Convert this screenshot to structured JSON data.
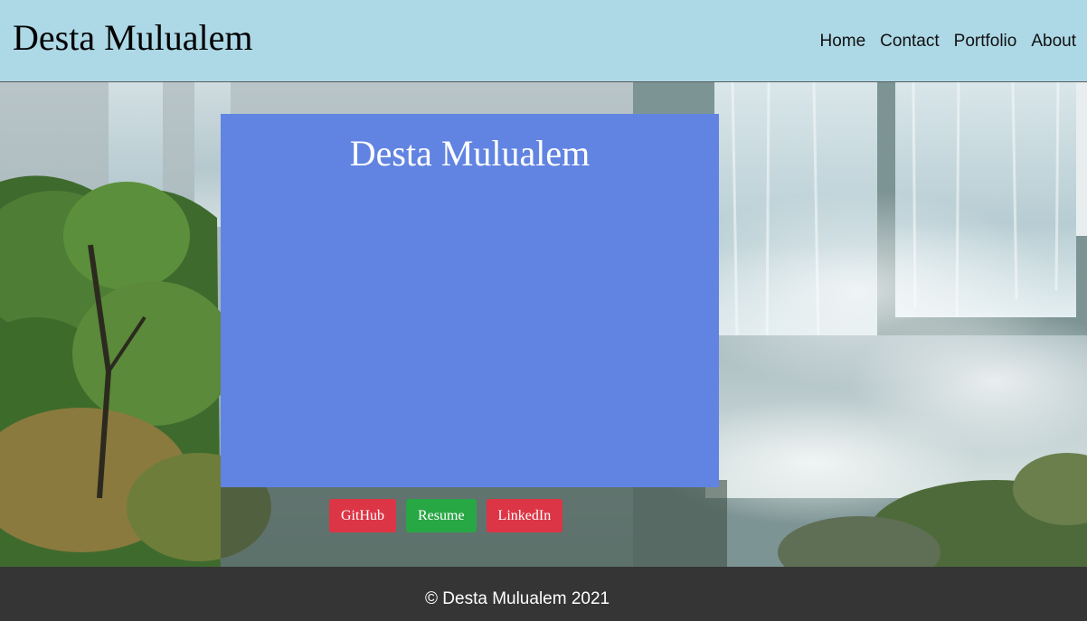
{
  "header": {
    "brand": "Desta Mulualem",
    "background": "#add8e6",
    "nav": [
      {
        "label": "Home"
      },
      {
        "label": "Contact"
      },
      {
        "label": "Portfolio"
      },
      {
        "label": "About"
      }
    ]
  },
  "hero": {
    "background_image": "waterfall-photo",
    "card": {
      "title": "Desta Mulualem",
      "background": "#6184e2"
    },
    "buttons": [
      {
        "label": "GitHub",
        "color": "#dc3545"
      },
      {
        "label": "Resume",
        "color": "#28a745"
      },
      {
        "label": "LinkedIn",
        "color": "#dc3545"
      }
    ]
  },
  "footer": {
    "text": "© Desta Mulualem 2021",
    "background": "#353535"
  }
}
